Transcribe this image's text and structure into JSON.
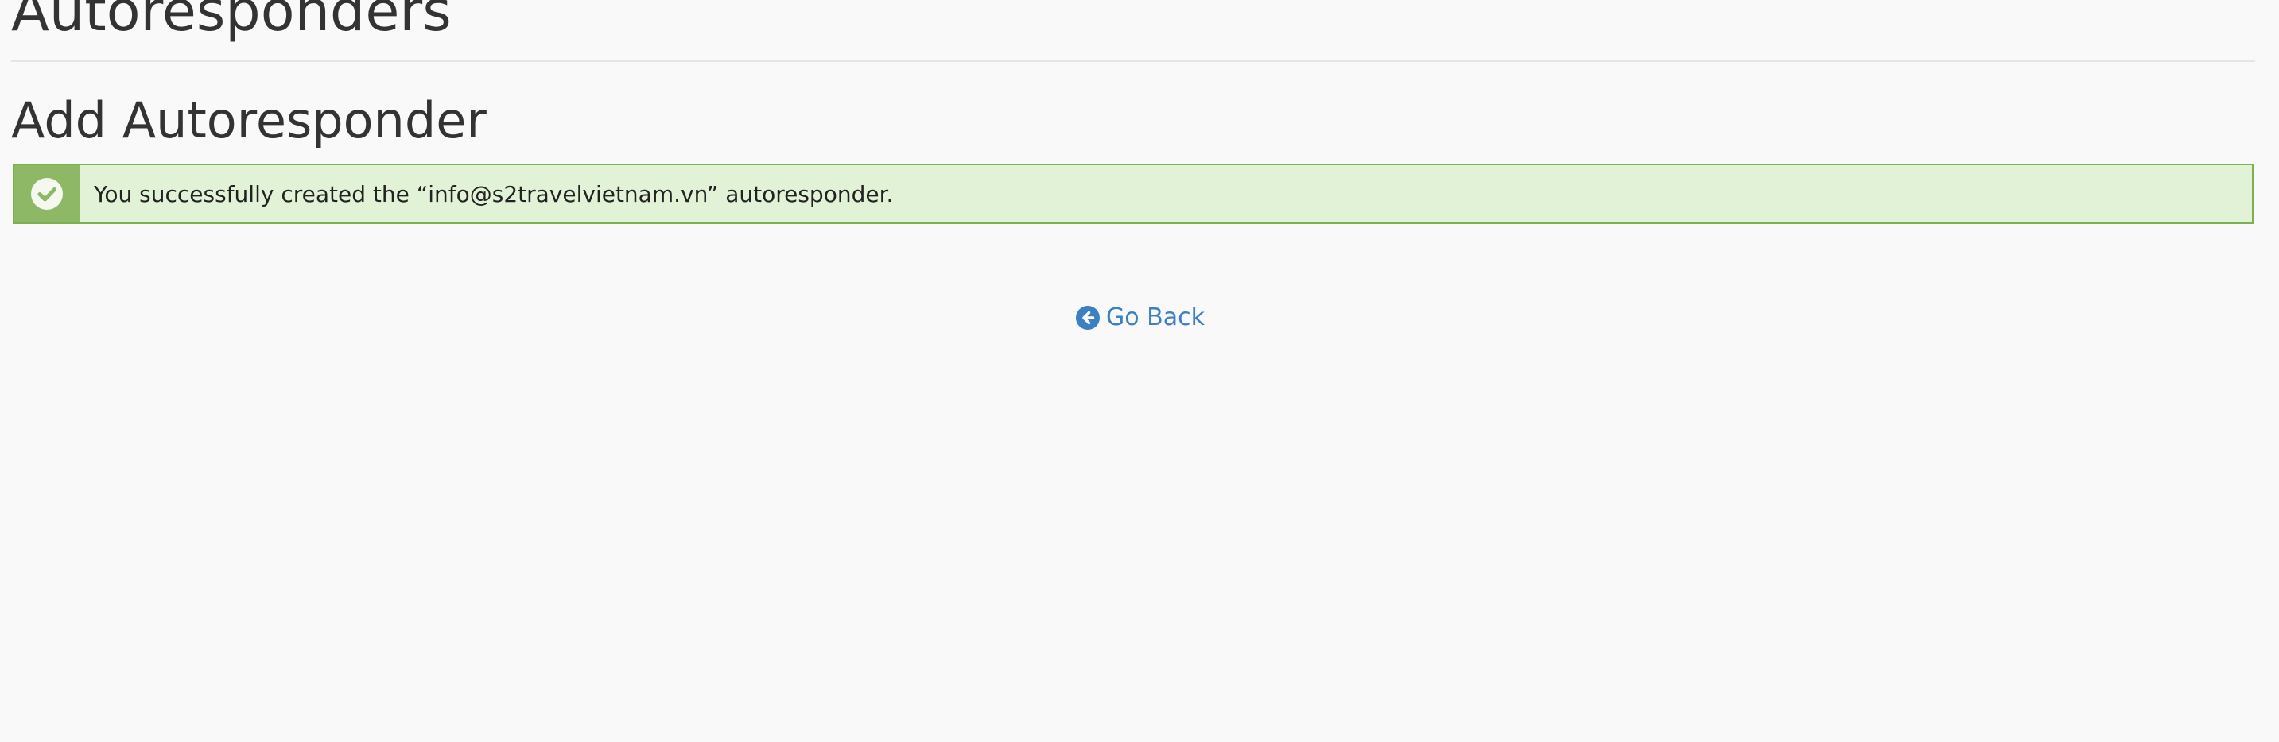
{
  "header": {
    "title": "Autoresponders"
  },
  "section": {
    "title": "Add Autoresponder"
  },
  "alert": {
    "type": "success",
    "icon": "check-circle-icon",
    "message": "You successfully created the “info@s2travelvietnam.vn” autoresponder.",
    "colors": {
      "border": "#7db14f",
      "background": "#e2f2d7",
      "icon_background": "#8eb865"
    }
  },
  "actions": {
    "go_back": {
      "label": "Go Back",
      "icon": "arrow-circle-left-icon",
      "color": "#3c80c4"
    }
  }
}
